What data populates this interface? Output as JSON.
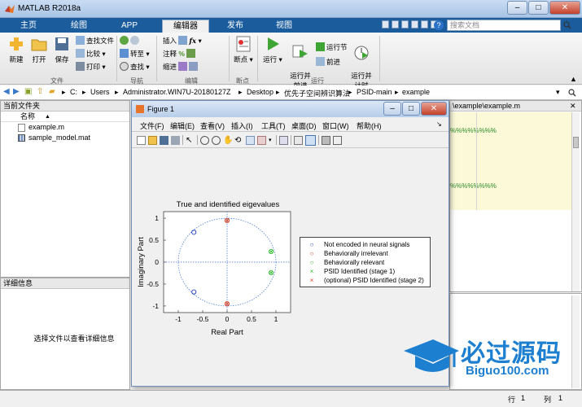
{
  "window": {
    "title": "MATLAB R2018a"
  },
  "tabs": [
    {
      "label": "主页"
    },
    {
      "label": "绘图"
    },
    {
      "label": "APP"
    },
    {
      "label": "编辑器"
    },
    {
      "label": "发布"
    },
    {
      "label": "视图"
    }
  ],
  "search": {
    "placeholder": "搜索文档"
  },
  "ribbon": {
    "file": {
      "new": "新建",
      "open": "打开",
      "save": "保存",
      "find_files": "查找文件",
      "compare": "比较",
      "print": "打印",
      "group": "文件"
    },
    "nav": {
      "goto": "转至",
      "find": "查找",
      "group": "导航"
    },
    "edit": {
      "insert": "插入",
      "comment": "注释",
      "indent": "缩进",
      "group": "编辑"
    },
    "breakpoints": {
      "label": "断点",
      "group": "断点"
    },
    "run": {
      "run": "运行",
      "run_advance": "运行并\n前进",
      "run_section": "运行节",
      "advance": "前进",
      "run_time": "运行并\n计时",
      "group": "运行"
    }
  },
  "address": {
    "path": [
      "C:",
      "Users",
      "Administrator.WIN7U-20180127Z",
      "Desktop",
      "优先子空间辨识算法",
      "PSID-main",
      "example"
    ]
  },
  "current_folder": {
    "title": "当前文件夹",
    "col_name": "名称",
    "sort_mark": "▲",
    "files": [
      {
        "name": "example.m"
      },
      {
        "name": "sample_model.mat"
      }
    ]
  },
  "details": {
    "title": "详细信息",
    "hint": "选择文件以查看详细信息"
  },
  "editor": {
    "tab_path": "\\example\\example.m",
    "cell_marks": "%%%%%%%%"
  },
  "figure": {
    "title": "Figure 1",
    "menu": [
      "文件(F)",
      "编辑(E)",
      "查看(V)",
      "插入(I)",
      "工具(T)",
      "桌面(D)",
      "窗口(W)",
      "帮助(H)"
    ]
  },
  "chart_data": {
    "type": "scatter",
    "title": "True and identified eigevalues",
    "xlabel": "Real Part",
    "ylabel": "Imaginary Part",
    "xlim": [
      -1.3,
      1.3
    ],
    "ylim": [
      -1.15,
      1.15
    ],
    "xticks": [
      "-1",
      "-0.5",
      "0",
      "0.5",
      "1"
    ],
    "yticks": [
      "1",
      "0.5",
      "0",
      "-0.5",
      "-1"
    ],
    "unit_circle": true,
    "legend_position": "right",
    "series": [
      {
        "name": "Not encoded in neural signals",
        "marker": "o",
        "color": "#1f3fc4",
        "x": [
          -0.68,
          -0.68
        ],
        "y": [
          0.68,
          -0.68
        ]
      },
      {
        "name": "Behaviorally irrelevant",
        "marker": "o",
        "color": "#d83a1b",
        "x": [
          0.0,
          0.0
        ],
        "y": [
          0.95,
          -0.95
        ]
      },
      {
        "name": "Behaviorally relevant",
        "marker": "o",
        "color": "#2db82d",
        "x": [
          0.9,
          0.9
        ],
        "y": [
          0.24,
          -0.24
        ]
      },
      {
        "name": "PSID Identified (stage 1)",
        "marker": "x",
        "color": "#2db82d",
        "x": [
          0.9,
          0.9
        ],
        "y": [
          0.24,
          -0.24
        ]
      },
      {
        "name": "(optional) PSID Identified (stage 2)",
        "marker": "x",
        "color": "#d83a1b",
        "x": [
          0.0,
          0.0
        ],
        "y": [
          0.95,
          -0.95
        ]
      }
    ]
  },
  "statusbar": {
    "row_label": "行",
    "row_value": "1",
    "col_label": "列",
    "col_value": "1"
  },
  "watermark": {
    "text": "必过源码",
    "url": "Biguo100.com"
  },
  "colors": {
    "tab_bar": "#1b5d9c",
    "editor_highlight": "#fbf9d8"
  }
}
